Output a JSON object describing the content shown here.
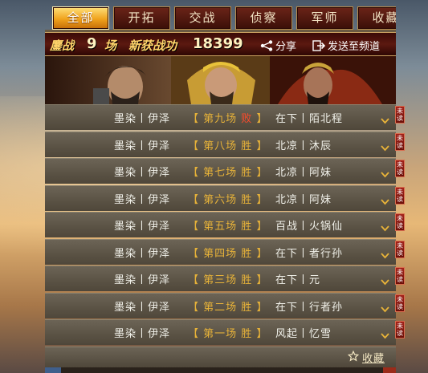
{
  "tabs": [
    {
      "label": "全部",
      "active": true
    },
    {
      "label": "开拓",
      "active": false
    },
    {
      "label": "交战",
      "active": false
    },
    {
      "label": "侦察",
      "active": false
    },
    {
      "label": "军师",
      "active": false
    },
    {
      "label": "收藏",
      "active": false
    }
  ],
  "header": {
    "battle_prefix": "鏖战",
    "battle_count": "9",
    "battle_suffix": "场",
    "merit_label": "新获战功",
    "merit_value": "18399",
    "share_label": "分享",
    "send_label": "发送至频道"
  },
  "rows": [
    {
      "names": "墨染丨伊泽",
      "match": "第九场",
      "result": "败",
      "result_kind": "lose",
      "opponent": "在下丨陌北程",
      "badge": "未读"
    },
    {
      "names": "墨染丨伊泽",
      "match": "第八场",
      "result": "胜",
      "result_kind": "win",
      "opponent": "北凉丨沐辰",
      "badge": "未读"
    },
    {
      "names": "墨染丨伊泽",
      "match": "第七场",
      "result": "胜",
      "result_kind": "win",
      "opponent": "北凉丨阿妹",
      "badge": "未读"
    },
    {
      "names": "墨染丨伊泽",
      "match": "第六场",
      "result": "胜",
      "result_kind": "win",
      "opponent": "北凉丨阿妹",
      "badge": "未读"
    },
    {
      "names": "墨染丨伊泽",
      "match": "第五场",
      "result": "胜",
      "result_kind": "win",
      "opponent": "百战丨火锅仙",
      "badge": "未读"
    },
    {
      "names": "墨染丨伊泽",
      "match": "第四场",
      "result": "胜",
      "result_kind": "win",
      "opponent": "在下丨者行孙",
      "badge": "未读"
    },
    {
      "names": "墨染丨伊泽",
      "match": "第三场",
      "result": "胜",
      "result_kind": "win",
      "opponent": "在下丨元",
      "badge": "未读"
    },
    {
      "names": "墨染丨伊泽",
      "match": "第二场",
      "result": "胜",
      "result_kind": "win",
      "opponent": "在下丨行者孙",
      "badge": "未读"
    },
    {
      "names": "墨染丨伊泽",
      "match": "第一场",
      "result": "胜",
      "result_kind": "win",
      "opponent": "风起丨忆雪",
      "badge": "未读"
    }
  ],
  "footer": {
    "favorite_label": "收藏"
  },
  "icons": {
    "share": "share-icon",
    "send": "send-to-channel-icon",
    "expand": "chevron-down-icon",
    "favorite": "star-outline-icon"
  },
  "colors": {
    "accent_gold": "#e8b339",
    "lose_red": "#ff4a2a",
    "active_tab": "#f0a21c"
  }
}
